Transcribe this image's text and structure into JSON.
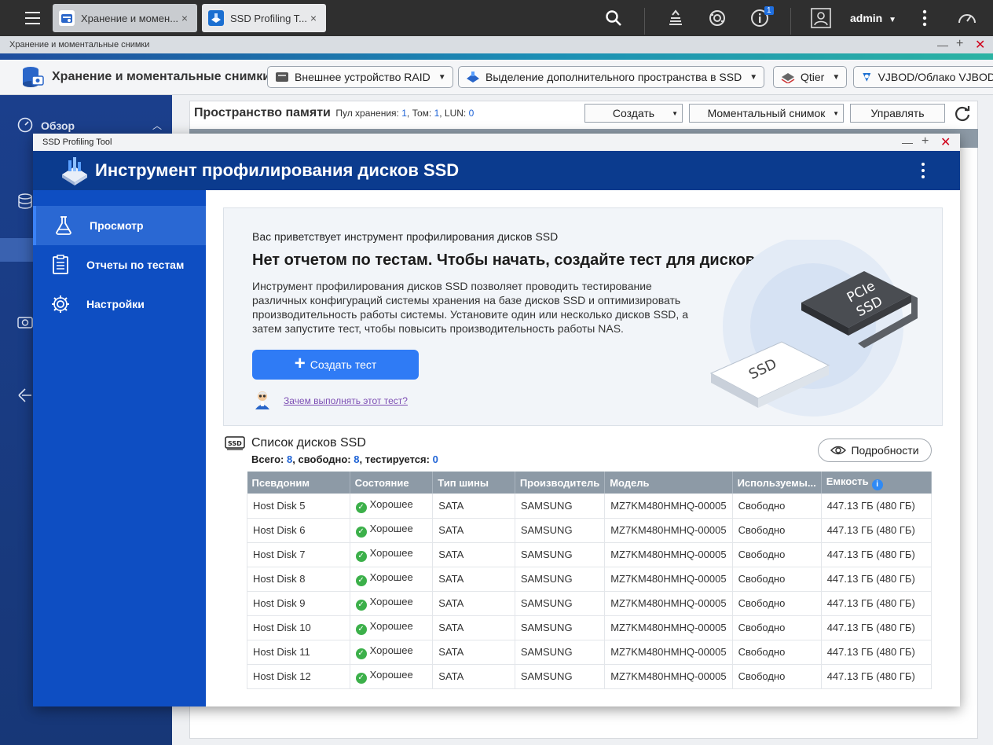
{
  "taskbar": {
    "tabs": [
      {
        "label": "Хранение и момен...",
        "close": "×"
      },
      {
        "label": "SSD Profiling T...",
        "close": "×"
      }
    ],
    "notification_count": "1",
    "user": "admin"
  },
  "storage_window": {
    "titlebar": "Хранение и моментальные снимки",
    "app_title": "Хранение и моментальные снимки",
    "toolbar": [
      {
        "label": "Внешнее устройство RAID"
      },
      {
        "label": "Выделение дополнительного пространства в SSD"
      },
      {
        "label": "Qtier"
      },
      {
        "label": "VJBOD/Облако VJBOD"
      }
    ],
    "sidebar": {
      "overview": "Обзор"
    },
    "section_title": "Пространство памяти",
    "summary": {
      "pool_label": "Пул хранения:",
      "pool_value": "1",
      "volume_label": "Том:",
      "volume_value": "1",
      "lun_label": "LUN:",
      "lun_value": "0"
    },
    "buttons": {
      "create": "Создать",
      "snapshot": "Моментальный снимок",
      "manage": "Управлять"
    }
  },
  "ssd_tool": {
    "titlebar": "SSD Profiling Tool",
    "header_title": "Инструмент профилирования дисков SSD",
    "nav": [
      {
        "label": "Просмотр",
        "icon": "flask-icon"
      },
      {
        "label": "Отчеты по тестам",
        "icon": "clipboard-icon"
      },
      {
        "label": "Настройки",
        "icon": "gear-icon"
      }
    ],
    "welcome": {
      "subtitle": "Вас приветствует инструмент профилирования дисков SSD",
      "headline": "Нет отчетом по тестам. Чтобы начать, создайте тест для дисков SSD.",
      "description": "Инструмент профилирования дисков SSD позволяет проводить тестирование различных конфигураций системы хранения на базе дисков SSD и оптимизировать производительность работы системы. Установите один или несколько дисков SSD, а затем запустите тест, чтобы повысить производительность работы NAS.",
      "create_button": "Создать тест",
      "why_link": "Зачем выполнять этот тест?",
      "illustration": {
        "ssd_label": "SSD",
        "pcie_label_1": "PCIe",
        "pcie_label_2": "SSD"
      }
    },
    "ssd_list": {
      "title": "Список дисков SSD",
      "stats": {
        "total_label": "Всего:",
        "total": "8",
        "free_label": ", свободно:",
        "free": "8",
        "testing_label": ", тестируется:",
        "testing": "0"
      },
      "details_button": "Подробности",
      "columns": [
        "Псевдоним",
        "Состояние",
        "Тип шины",
        "Производитель",
        "Модель",
        "Используемы...",
        "Емкость"
      ],
      "rows": [
        {
          "alias": "Host Disk 5",
          "status": "Хорошее",
          "bus": "SATA",
          "vendor": "SAMSUNG",
          "model": "MZ7KM480HMHQ-00005",
          "usage": "Свободно",
          "capacity": "447.13 ГБ (480 ГБ)"
        },
        {
          "alias": "Host Disk 6",
          "status": "Хорошее",
          "bus": "SATA",
          "vendor": "SAMSUNG",
          "model": "MZ7KM480HMHQ-00005",
          "usage": "Свободно",
          "capacity": "447.13 ГБ (480 ГБ)"
        },
        {
          "alias": "Host Disk 7",
          "status": "Хорошее",
          "bus": "SATA",
          "vendor": "SAMSUNG",
          "model": "MZ7KM480HMHQ-00005",
          "usage": "Свободно",
          "capacity": "447.13 ГБ (480 ГБ)"
        },
        {
          "alias": "Host Disk 8",
          "status": "Хорошее",
          "bus": "SATA",
          "vendor": "SAMSUNG",
          "model": "MZ7KM480HMHQ-00005",
          "usage": "Свободно",
          "capacity": "447.13 ГБ (480 ГБ)"
        },
        {
          "alias": "Host Disk 9",
          "status": "Хорошее",
          "bus": "SATA",
          "vendor": "SAMSUNG",
          "model": "MZ7KM480HMHQ-00005",
          "usage": "Свободно",
          "capacity": "447.13 ГБ (480 ГБ)"
        },
        {
          "alias": "Host Disk 10",
          "status": "Хорошее",
          "bus": "SATA",
          "vendor": "SAMSUNG",
          "model": "MZ7KM480HMHQ-00005",
          "usage": "Свободно",
          "capacity": "447.13 ГБ (480 ГБ)"
        },
        {
          "alias": "Host Disk 11",
          "status": "Хорошее",
          "bus": "SATA",
          "vendor": "SAMSUNG",
          "model": "MZ7KM480HMHQ-00005",
          "usage": "Свободно",
          "capacity": "447.13 ГБ (480 ГБ)"
        },
        {
          "alias": "Host Disk 12",
          "status": "Хорошее",
          "bus": "SATA",
          "vendor": "SAMSUNG",
          "model": "MZ7KM480HMHQ-00005",
          "usage": "Свободно",
          "capacity": "447.13 ГБ (480 ГБ)"
        }
      ]
    }
  },
  "colors": {
    "header_blue": "#0b3b8e",
    "nav_blue": "#0e4ec2",
    "button_blue": "#2f7bf5",
    "ok_green": "#3cb04a",
    "table_header": "#8d9aa6"
  }
}
